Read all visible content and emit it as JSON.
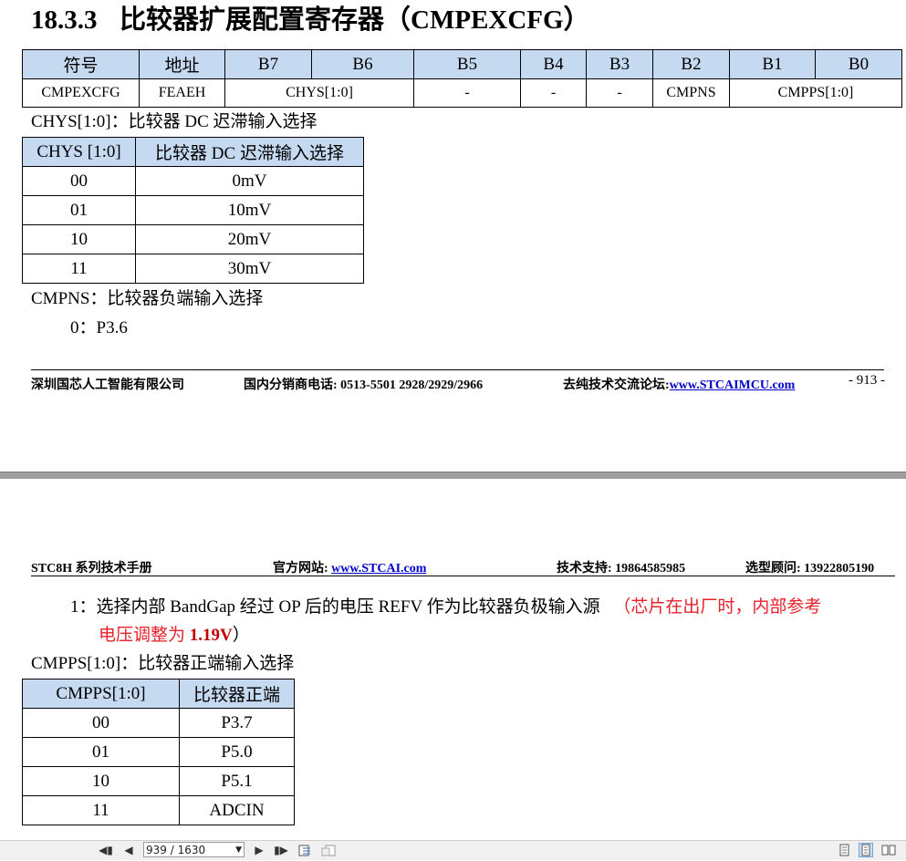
{
  "section": {
    "number": "18.3.3",
    "title": "比较器扩展配置寄存器（CMPEXCFG）"
  },
  "register_table": {
    "headers": [
      "符号",
      "地址",
      "B7",
      "B6",
      "B5",
      "B4",
      "B3",
      "B2",
      "B1",
      "B0"
    ],
    "row": {
      "symbol": "CMPEXCFG",
      "address": "FEAEH",
      "b7_b6": "CHYS[1:0]",
      "b5": "-",
      "b4": "-",
      "b3": "-",
      "b2": "CMPNS",
      "b1_b0": "CMPPS[1:0]"
    }
  },
  "chys": {
    "caption": "CHYS[1:0]：比较器 DC 迟滞输入选择",
    "headers": [
      "CHYS [1:0]",
      "比较器 DC 迟滞输入选择"
    ],
    "rows": [
      {
        "code": "00",
        "value": "0mV"
      },
      {
        "code": "01",
        "value": "10mV"
      },
      {
        "code": "10",
        "value": "20mV"
      },
      {
        "code": "11",
        "value": "30mV"
      }
    ]
  },
  "cmpns": {
    "caption": "CMPNS：比较器负端输入选择",
    "option0": "0：P3.6",
    "option1_text": "1：选择内部 BandGap 经过 OP 后的电压 REFV 作为比较器负极输入源",
    "option1_note_a": "（芯片在出厂时，内部参考",
    "option1_note_b": "电压调整为 ",
    "option1_note_value": "1.19V",
    "option1_note_end": "）"
  },
  "cmpps": {
    "caption": "CMPPS[1:0]：比较器正端输入选择",
    "headers": [
      "CMPPS[1:0]",
      "比较器正端"
    ],
    "rows": [
      {
        "code": "00",
        "value": "P3.7"
      },
      {
        "code": "01",
        "value": "P5.0"
      },
      {
        "code": "10",
        "value": "P5.1"
      },
      {
        "code": "11",
        "value": "ADCIN"
      }
    ]
  },
  "footer": {
    "company": "深圳国芯人工智能有限公司",
    "distributor": "国内分销商电话: 0513-5501 2928/2929/2966",
    "forum_label": "去纯技术交流论坛:",
    "forum_link": "www.STCAIMCU.com",
    "page": "- 913 -"
  },
  "header2": {
    "manual": "STC8H 系列技术手册",
    "site_label": "官方网站: ",
    "site_link": "www.STCAI.com",
    "support": "技术支持: 19864585985",
    "advisor": "选型顾问: 13922805190"
  },
  "toolbar": {
    "page_indicator": "939 / 1630",
    "icons": [
      "first-page-icon",
      "prev-page-icon",
      "next-page-icon",
      "last-page-icon",
      "go-back-icon",
      "go-forward-icon",
      "single-page-icon",
      "continuous-page-icon",
      "two-page-icon"
    ]
  }
}
